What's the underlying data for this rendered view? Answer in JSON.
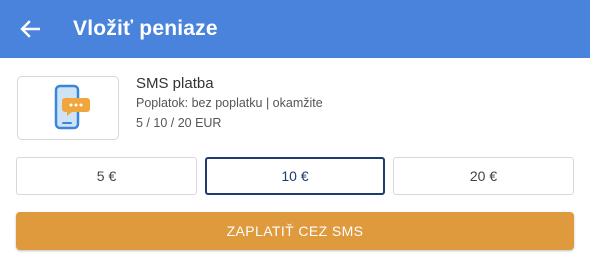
{
  "header": {
    "title": "Vložiť peniaze",
    "back_icon": "arrow-left-icon",
    "background_color": "#4a83dc"
  },
  "payment_method": {
    "icon": "sms-phone-icon",
    "name": "SMS platba",
    "fee_text": "Poplatok: bez poplatku | okamžite",
    "amounts_text": "5 / 10 / 20 EUR"
  },
  "amount_options": [
    {
      "label": "5 €",
      "selected": false
    },
    {
      "label": "10 €",
      "selected": true
    },
    {
      "label": "20 €",
      "selected": false
    }
  ],
  "pay_button": {
    "label": "ZAPLATIŤ CEZ SMS",
    "color": "#de9a3c"
  }
}
